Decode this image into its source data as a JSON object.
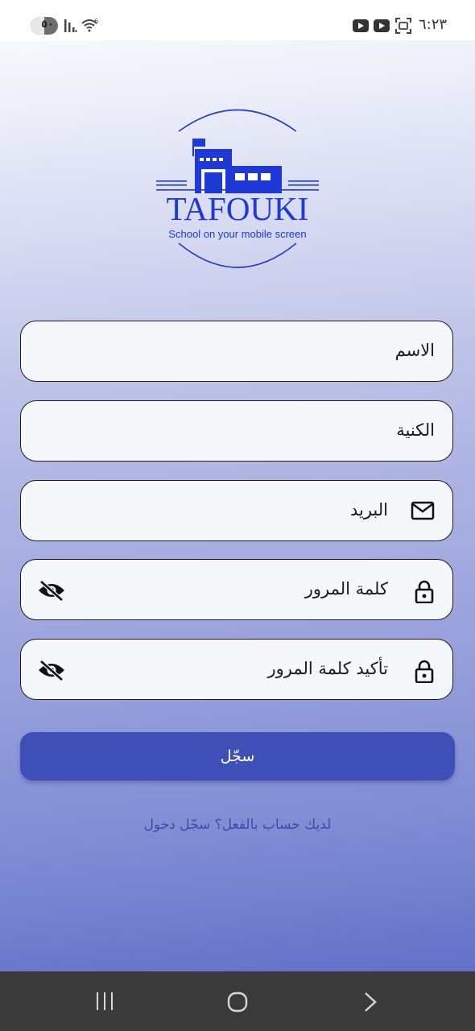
{
  "status_bar": {
    "time": "٦:٢٣",
    "battery_level": "٥٠",
    "battery_fraction": 0.5,
    "icons": [
      "battery-icon",
      "signal-icon",
      "wifi-icon",
      "youtube-icon",
      "youtube-icon",
      "screenshot-icon"
    ]
  },
  "logo": {
    "name": "TAFOUKI",
    "tagline": "School on your mobile screen",
    "color": "#1f39d6"
  },
  "form": {
    "first_name_placeholder": "الاسم",
    "last_name_placeholder": "الكنية",
    "email_placeholder": "البريد",
    "password_placeholder": "كلمة المرور",
    "confirm_password_placeholder": "تأكيد كلمة المرور",
    "icons": {
      "email": "mail-icon",
      "password": "lock-icon",
      "visibility": "eye-off-icon"
    }
  },
  "register_button": {
    "label": "سجّل",
    "color": "#3e4fb8"
  },
  "login_link": {
    "text": "لديك حساب بالفعل؟ سجّل دخول"
  },
  "nav_bar": {
    "icons": [
      "recent-apps-icon",
      "home-icon",
      "back-icon"
    ]
  }
}
